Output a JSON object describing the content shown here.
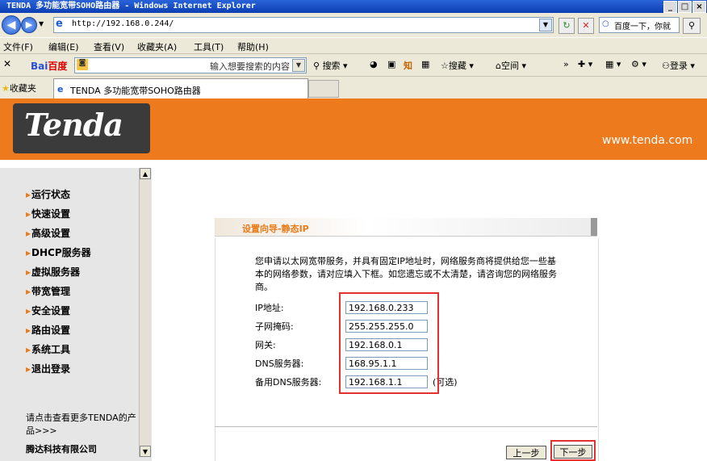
{
  "window": {
    "title": "TENDA 多功能宽带SOHO路由器 - Windows Internet Explorer"
  },
  "address": {
    "url": "http://192.168.0.244/"
  },
  "search": {
    "placeholder": "百度一下，你就"
  },
  "menu": [
    "文件(F)",
    "编辑(E)",
    "查看(V)",
    "收藏夹(A)",
    "工具(T)",
    "帮助(H)"
  ],
  "toolbar": {
    "baidu_logo": "Bai",
    "baidu_logo2": "百度",
    "baidu_placeholder": "输入想要搜索的内容",
    "search_label": "搜索",
    "zhi_label": "知",
    "souzang_label": "搜藏",
    "space_label": "空间",
    "login_label": "登录"
  },
  "favorites": {
    "label": "收藏夹",
    "tab_title": "TENDA 多功能宽带SOHO路由器"
  },
  "header": {
    "site": "www.tenda.com",
    "logo_text": "Tenda"
  },
  "sidebar": {
    "items": [
      "运行状态",
      "快速设置",
      "高级设置",
      "DHCP服务器",
      "虚拟服务器",
      "带宽管理",
      "安全设置",
      "路由设置",
      "系统工具",
      "退出登录"
    ],
    "footer_link": "请点击查看更多TENDA的产品>>>",
    "company": "腾达科技有限公司"
  },
  "wizard": {
    "title": "设置向导-静态IP",
    "description": "您申请以太网宽带服务，并具有固定IP地址时，网络服务商将提供给您一些基本的网络参数，请对应填入下框。如您遗忘或不太清楚，请咨询您的网络服务商。",
    "fields": [
      {
        "label": "IP地址:",
        "value": "192.168.0.233"
      },
      {
        "label": "子网掩码:",
        "value": "255.255.255.0"
      },
      {
        "label": "网关:",
        "value": "192.168.0.1"
      },
      {
        "label": "DNS服务器:",
        "value": "168.95.1.1"
      },
      {
        "label": "备用DNS服务器:",
        "value": "192.168.1.1"
      }
    ],
    "optional": "(可选)",
    "prev_label": "上一步",
    "next_label": "下一步"
  },
  "colors": {
    "brand_orange": "#ee7a1e",
    "highlight_red": "#e4302f",
    "title_blue": "#0b3fb3"
  }
}
